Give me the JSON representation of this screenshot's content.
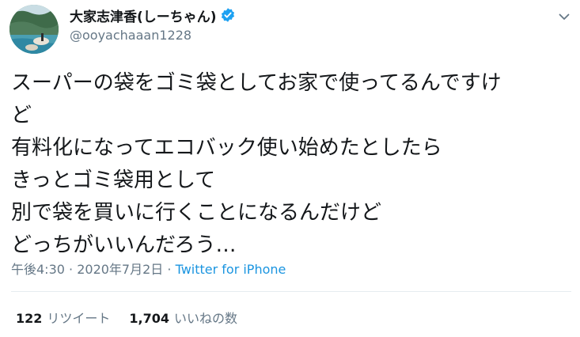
{
  "author": {
    "display_name": "大家志津香(しーちゃん)",
    "handle": "@ooyachaaan1228",
    "verified_icon": "verified-badge-icon",
    "verified_color": "#1da1f2"
  },
  "tweet": {
    "lines": [
      "スーパーの袋をゴミ袋としてお家で使ってるんですけ",
      "ど",
      "有料化になってエコバック使い始めたとしたら",
      "きっとゴミ袋用として",
      "別で袋を買いに行くことになるんだけど",
      "どっちがいいんだろう…"
    ]
  },
  "meta": {
    "time": "午後4:30",
    "date": "2020年7月2日",
    "separator": "·",
    "source": "Twitter for iPhone"
  },
  "stats": {
    "retweets_count": "122",
    "retweets_label": "リツイート",
    "likes_count": "1,704",
    "likes_label": "いいねの数"
  },
  "colors": {
    "link": "#1b95e0",
    "secondary_text": "#657786",
    "primary_text": "#14171a",
    "divider": "#e6ecf0"
  }
}
